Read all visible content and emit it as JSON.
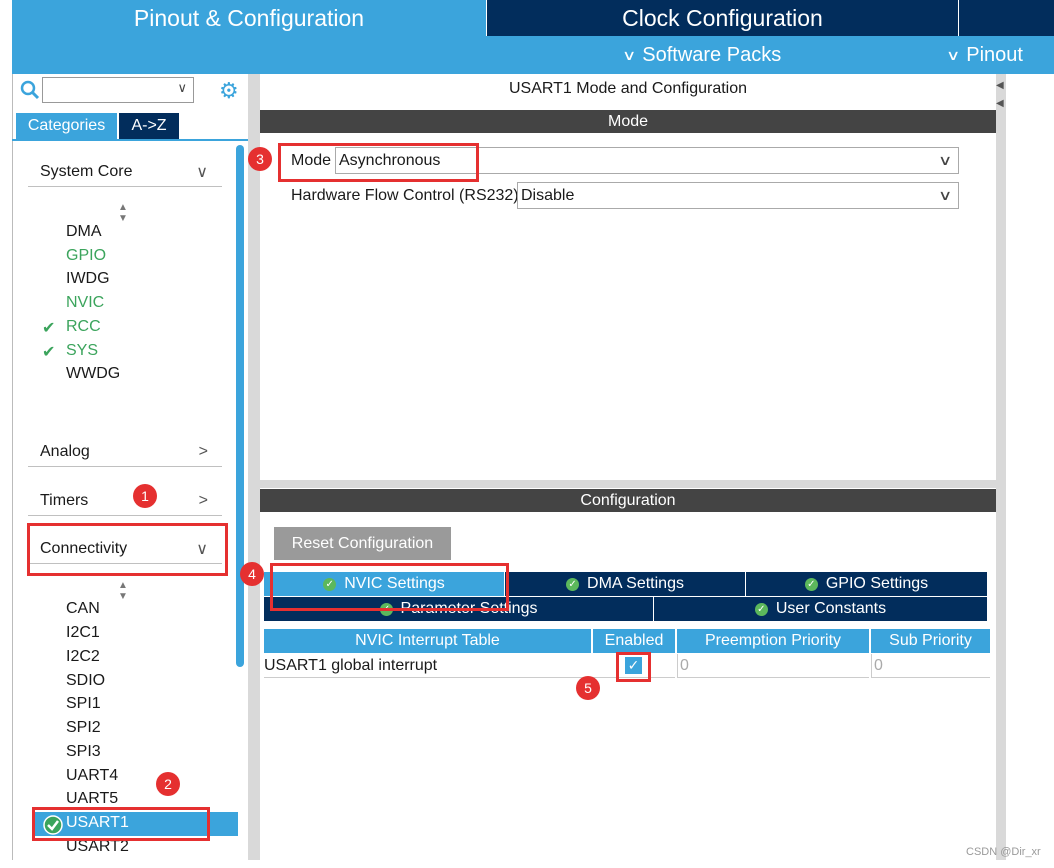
{
  "top_tabs": {
    "pinout": "Pinout & Configuration",
    "clock": "Clock Configuration"
  },
  "subbar": {
    "software_packs": "Software Packs",
    "pinout": "Pinout"
  },
  "left": {
    "search_placeholder": "",
    "tabs": {
      "categories": "Categories",
      "az": "A->Z"
    },
    "system_core": {
      "label": "System Core",
      "items": [
        {
          "label": "DMA",
          "state": "normal"
        },
        {
          "label": "GPIO",
          "state": "green"
        },
        {
          "label": "IWDG",
          "state": "normal"
        },
        {
          "label": "NVIC",
          "state": "green"
        },
        {
          "label": "RCC",
          "state": "checked"
        },
        {
          "label": "SYS",
          "state": "checked"
        },
        {
          "label": "WWDG",
          "state": "normal"
        }
      ]
    },
    "analog": "Analog",
    "timers": "Timers",
    "connectivity": {
      "label": "Connectivity",
      "items": [
        "CAN",
        "I2C1",
        "I2C2",
        "SDIO",
        "SPI1",
        "SPI2",
        "SPI3",
        "UART4",
        "UART5",
        "USART1",
        "USART2"
      ],
      "selected": "USART1"
    }
  },
  "mode_panel": {
    "title": "USART1 Mode and Configuration",
    "section": "Mode",
    "mode_label": "Mode",
    "mode_value": "Asynchronous",
    "flow_label": "Hardware Flow Control (RS232)",
    "flow_value": "Disable"
  },
  "config_panel": {
    "section": "Configuration",
    "reset_button": "Reset Configuration",
    "tabs": [
      "NVIC Settings",
      "DMA Settings",
      "GPIO Settings",
      "Parameter Settings",
      "User Constants"
    ],
    "active_tab": "NVIC Settings",
    "table": {
      "headers": [
        "NVIC Interrupt Table",
        "Enabled",
        "Preemption Priority",
        "Sub Priority"
      ],
      "rows": [
        {
          "name": "USART1 global interrupt",
          "enabled": true,
          "preemption": "0",
          "sub": "0"
        }
      ]
    }
  },
  "annotations": [
    "1",
    "2",
    "3",
    "4",
    "5"
  ],
  "watermark": "CSDN @Dir_xr",
  "colors": {
    "accent": "#3ba4dc",
    "navy": "#022d5c",
    "green": "#3ba45c",
    "annotation_red": "#e53030"
  }
}
